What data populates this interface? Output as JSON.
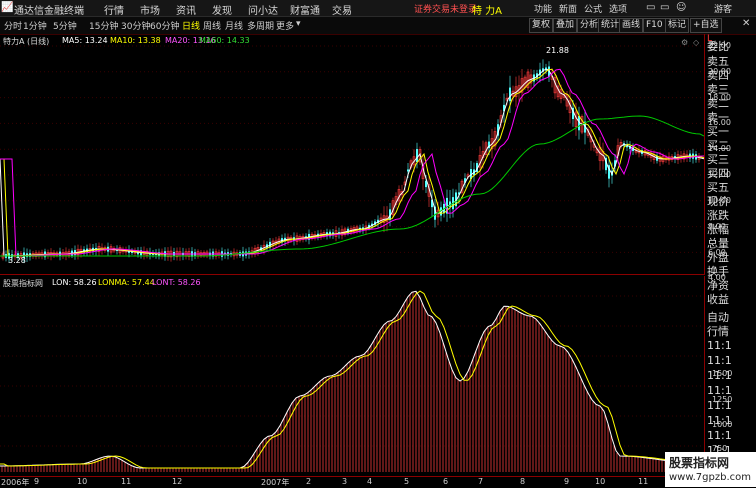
{
  "menu": {
    "logo_text": "通达信金融终端",
    "items": [
      "行情",
      "市场",
      "资讯",
      "发现",
      "问小达",
      "财富通",
      "交易"
    ],
    "login_status": "证券交易未登录",
    "stock_name": "特 力A",
    "right_items": [
      "功能",
      "新面",
      "公式",
      "选项"
    ],
    "guest": "游客"
  },
  "periods": [
    "分时",
    "1分钟",
    "5分钟",
    "15分钟",
    "30分钟",
    "60分钟",
    "日线",
    "周线",
    "月线",
    "多周期",
    "更多"
  ],
  "active_period": "日线",
  "right_buttons": [
    "复权",
    "叠加",
    "分析",
    "统计",
    "画线",
    "F10",
    "标记",
    "+自选"
  ],
  "main_legend": {
    "title": "特力A (日线)",
    "ma5": "MA5: 13.24",
    "ma10": "MA10: 13.38",
    "ma20": "MA20: 13.16",
    "ma60": "MA60: 14.33"
  },
  "price_high_label": "21.88",
  "price_low_label": "3.28",
  "price_axis": [
    "22.00",
    "20.00",
    "18.00",
    "16.00",
    "14.00",
    "12.00",
    "10.00",
    "8.00",
    "6.00",
    "4.00"
  ],
  "sub_legend": {
    "title": "股票指标网",
    "lon": "LON: 58.26",
    "lonma": "LONMA: 57.44",
    "lont": "LONT: 58.26"
  },
  "sub_axis": [
    "1500",
    "1250",
    "1000",
    "750",
    "500"
  ],
  "x_axis": [
    "2006年",
    "9",
    "10",
    "11",
    "12",
    "2007年",
    "2",
    "3",
    "4",
    "5",
    "6",
    "7",
    "8",
    "9",
    "10",
    "11"
  ],
  "side_panel": {
    "top": "L",
    "orders": [
      "委比",
      "卖五",
      "卖四",
      "卖三",
      "卖二",
      "卖一",
      "买一",
      "买二",
      "买三",
      "买四",
      "买五"
    ],
    "stats": [
      "现价",
      "涨跌",
      "涨幅",
      "总量",
      "外盘",
      "换手",
      "净资",
      "收益"
    ],
    "ticks_title": "自动",
    "ticks_sub": "行情",
    "times": [
      "11:1",
      "11:1",
      "11:1",
      "11:1",
      "11:1",
      "11:1",
      "11:1",
      "11:1",
      "11:1",
      "11:1"
    ]
  },
  "watermark": {
    "line1": "股票指标网",
    "line2": "www.7gpzb.com"
  },
  "colors": {
    "up": "#ff3c3c",
    "down": "#54ffff",
    "ma5": "#ffffff",
    "ma10": "#ffff00",
    "ma20": "#ff00ff",
    "ma60": "#00c800",
    "accent": "#ff3300"
  }
}
